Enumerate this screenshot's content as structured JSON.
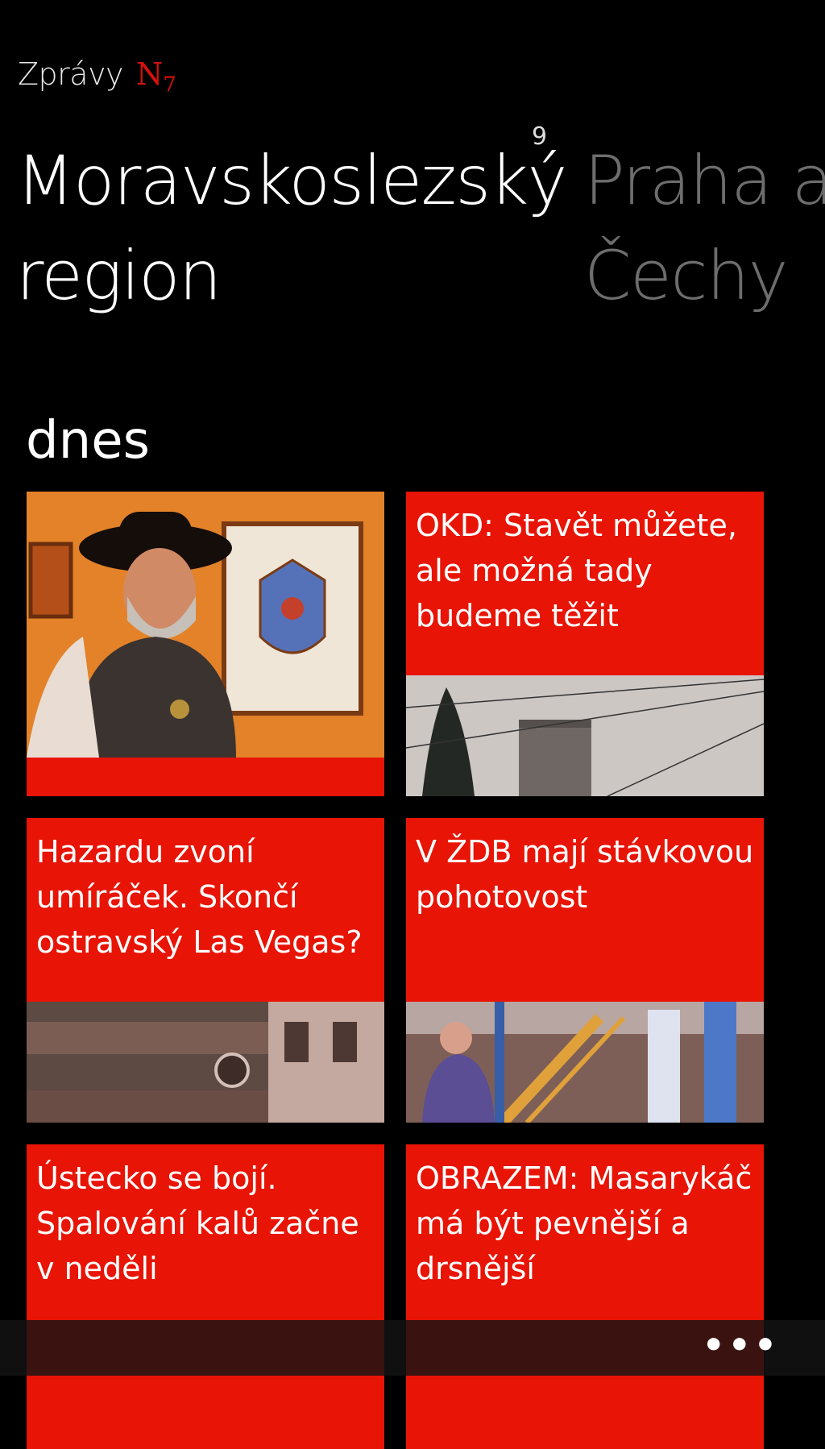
{
  "app": {
    "title": "Zprávy",
    "logo_letter": "N",
    "logo_sub": "7"
  },
  "pivot": {
    "current": "Moravskoslezský region",
    "count": "9",
    "next": "Praha a Čechy"
  },
  "section": {
    "title": "dnes"
  },
  "tiles": [
    {
      "headline": ""
    },
    {
      "headline": "OKD: Stavět můžete, ale možná tady budeme těžit"
    },
    {
      "headline": "Hazardu zvoní umíráček. Skončí ostravský Las Vegas?"
    },
    {
      "headline": "V ŽDB mají stávkovou pohotovost"
    },
    {
      "headline": "Ústecko se bojí. Spalování kalů začne v neděli"
    },
    {
      "headline": "OBRAZEM: Masarykáč má být pevnější a drsnější"
    }
  ],
  "appbar": {
    "more_label": "•••"
  },
  "colors": {
    "accent": "#e81405",
    "background": "#000000",
    "inactive_pivot": "#6d6d6d"
  }
}
